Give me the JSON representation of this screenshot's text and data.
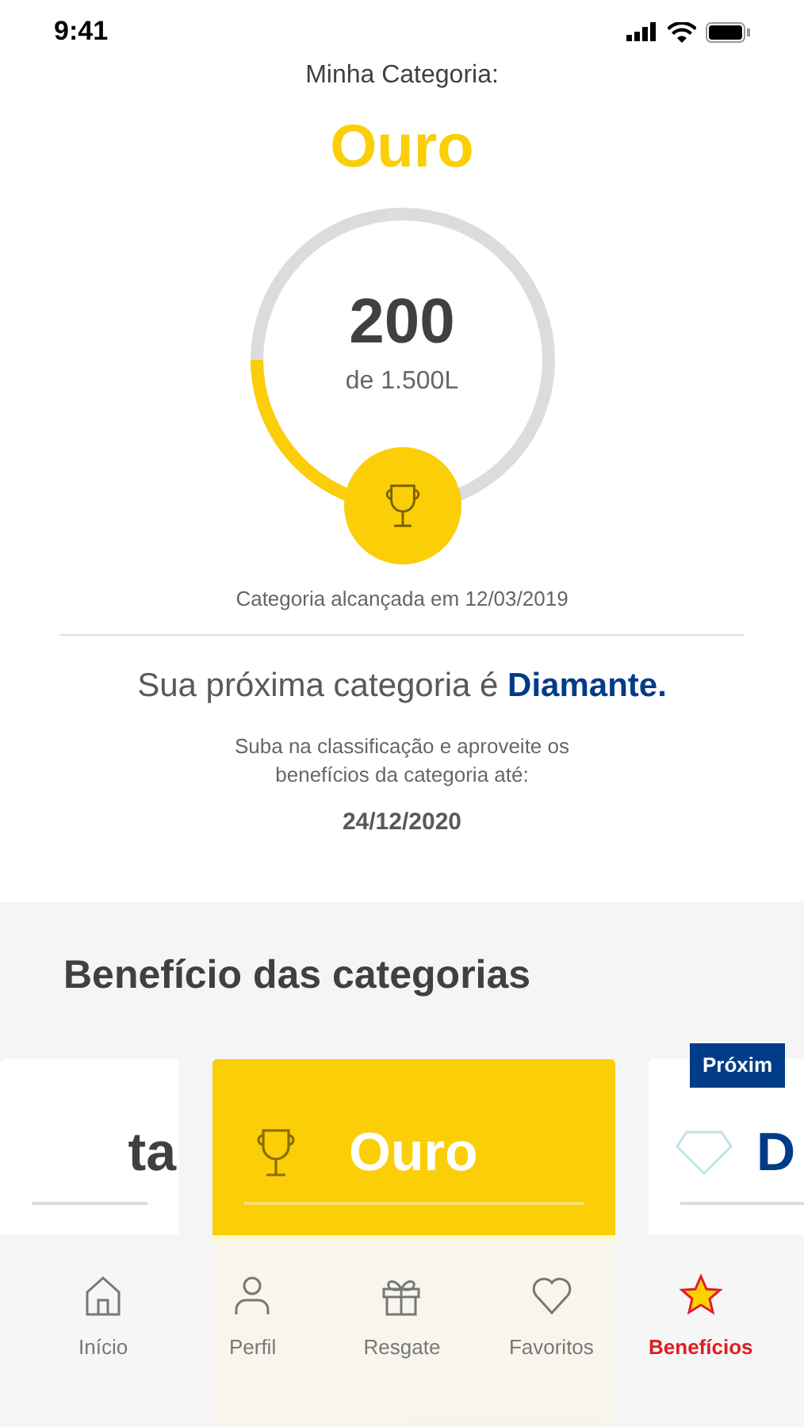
{
  "status_bar": {
    "time": "9:41"
  },
  "category": {
    "label": "Minha Categoria:",
    "name": "Ouro",
    "points": "200",
    "goal": "de 1.500L",
    "level": 0.25,
    "reached": "Categoria alcançada em 12/03/2019"
  },
  "next": {
    "text": "Sua próxima categoria é **Diamante.**",
    "subtitle": "Suba na classificação e aproveite os benefícios da categoria até:",
    "date": "24/12/2020"
  },
  "benefits": {
    "heading": "Benefício das categorias",
    "cards": [
      {
        "kind": "plain",
        "title": "ta",
        "selected": false
      },
      {
        "kind": "trophy",
        "title": "Ouro",
        "selected": true
      },
      {
        "kind": "diamond",
        "title": "D",
        "selected": false,
        "badge": "Próxim"
      }
    ]
  },
  "nav": [
    {
      "kind": "home",
      "label": "Início",
      "selected": false
    },
    {
      "kind": "person",
      "label": "Perfil",
      "selected": false
    },
    {
      "kind": "gift",
      "label": "Resgate",
      "selected": false
    },
    {
      "kind": "heart",
      "label": "Favoritos",
      "selected": false
    },
    {
      "kind": "star",
      "label": "Benefícios",
      "selected": true
    }
  ]
}
